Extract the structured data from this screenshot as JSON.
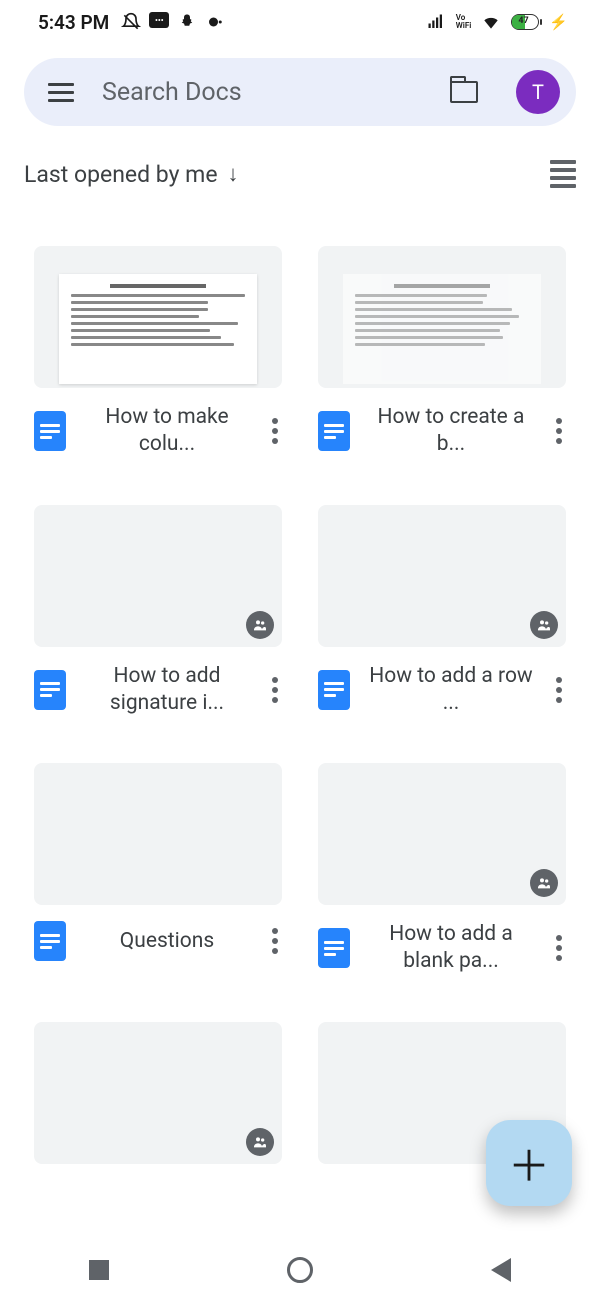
{
  "status": {
    "time": "5:43 PM",
    "battery": "47",
    "vowifi": "Vo\nWiFi"
  },
  "search": {
    "placeholder": "Search Docs",
    "avatar_initial": "T"
  },
  "sort": {
    "label": "Last opened by me"
  },
  "docs": [
    {
      "title": "How to make colu...",
      "shared": false,
      "preview": true,
      "faded": false
    },
    {
      "title": "How to create a b...",
      "shared": false,
      "preview": true,
      "faded": true
    },
    {
      "title": "How to add signature i...",
      "shared": true,
      "preview": false
    },
    {
      "title": "How to add a row ...",
      "shared": true,
      "preview": false
    },
    {
      "title": "Questions",
      "shared": false,
      "preview": false
    },
    {
      "title": "How to add a blank pa...",
      "shared": true,
      "preview": false
    },
    {
      "title": "",
      "shared": true,
      "preview": false
    },
    {
      "title": "",
      "shared": true,
      "preview": false
    }
  ]
}
